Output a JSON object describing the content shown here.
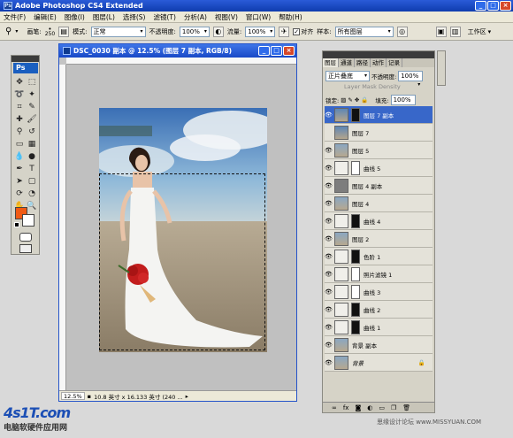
{
  "window": {
    "title": "Adobe Photoshop CS4 Extended"
  },
  "menu": [
    "文件(F)",
    "编辑(E)",
    "图像(I)",
    "图层(L)",
    "选择(S)",
    "滤镜(T)",
    "分析(A)",
    "视图(V)",
    "窗口(W)",
    "帮助(H)"
  ],
  "options": {
    "brush_label": "画笔:",
    "brush_size": "250",
    "mode_label": "模式:",
    "mode_value": "正常",
    "opacity_label": "不透明度:",
    "opacity_value": "100%",
    "flow_label": "流量:",
    "flow_value": "100%",
    "aligned_label": "对齐",
    "sample_label": "样本:",
    "sample_value": "所有图层",
    "workspace_label": "工作区"
  },
  "toolbox": {
    "logo": "Ps"
  },
  "document": {
    "title": "DSC_0030 副本 @ 12.5% (图层 7 副本, RGB/8)",
    "zoom": "12.5%",
    "status": "10.8 英寸 x 16.133 英寸 (240 ..."
  },
  "layers_panel": {
    "tabs": [
      "图层",
      "通道",
      "路径",
      "动作",
      "记录"
    ],
    "blend_mode": "正片叠底",
    "opacity_label": "不透明度:",
    "opacity_value": "100%",
    "layer_mask_label": "Layer Mask Density",
    "lock_label": "锁定:",
    "fill_label": "填充:",
    "fill_value": "100%",
    "layers": [
      {
        "name": "图层 7 副本",
        "visible": true,
        "selected": true
      },
      {
        "name": "图层 7",
        "visible": false,
        "selected": false
      },
      {
        "name": "图层 5",
        "visible": true,
        "selected": false
      },
      {
        "name": "曲线 5",
        "visible": true,
        "selected": false
      },
      {
        "name": "图层 4 副本",
        "visible": true,
        "selected": false
      },
      {
        "name": "图层 4",
        "visible": true,
        "selected": false
      },
      {
        "name": "曲线 4",
        "visible": true,
        "selected": false
      },
      {
        "name": "图层 2",
        "visible": true,
        "selected": false
      },
      {
        "name": "色阶 1",
        "visible": true,
        "selected": false
      },
      {
        "name": "照片滤镜 1",
        "visible": true,
        "selected": false
      },
      {
        "name": "曲线 3",
        "visible": true,
        "selected": false
      },
      {
        "name": "曲线 2",
        "visible": true,
        "selected": false
      },
      {
        "name": "曲线 1",
        "visible": true,
        "selected": false
      },
      {
        "name": "背景 副本",
        "visible": true,
        "selected": false
      },
      {
        "name": "背景",
        "visible": true,
        "selected": false
      }
    ],
    "bottom_icons": [
      "link-icon",
      "fx-icon",
      "mask-icon",
      "adjustment-icon",
      "folder-icon",
      "new-layer-icon",
      "trash-icon"
    ]
  },
  "watermark_left": {
    "brand": "4s1T.com",
    "text": "电脑软硬件应用网"
  },
  "watermark_right": "思缘设计论坛 www.MISSYUAN.COM"
}
